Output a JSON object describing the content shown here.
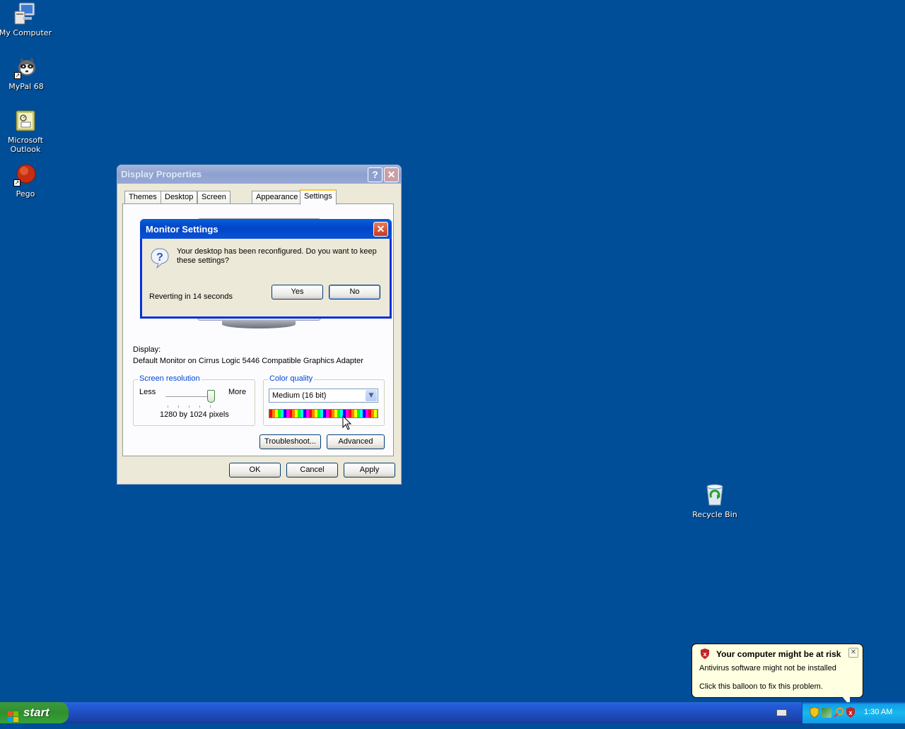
{
  "desktop": {
    "icons": [
      {
        "label": "My Computer"
      },
      {
        "label": "MyPal 68"
      },
      {
        "label": "Microsoft Outlook"
      },
      {
        "label": "Pego"
      },
      {
        "label": "Recycle Bin"
      }
    ]
  },
  "display_properties": {
    "title": "Display Properties",
    "tabs": [
      "Themes",
      "Desktop",
      "Screen Saver",
      "Appearance",
      "Settings"
    ],
    "selected_tab": "Settings",
    "display_label": "Display:",
    "display_value": "Default Monitor on Cirrus Logic 5446 Compatible Graphics Adapter",
    "screen_resolution": {
      "group_label": "Screen resolution",
      "less_label": "Less",
      "more_label": "More",
      "value_text": "1280 by 1024 pixels",
      "slider_level": 1.0
    },
    "color_quality": {
      "group_label": "Color quality",
      "selected": "Medium (16 bit)"
    },
    "buttons": {
      "troubleshoot": "Troubleshoot...",
      "advanced": "Advanced",
      "ok": "OK",
      "cancel": "Cancel",
      "apply": "Apply"
    }
  },
  "monitor_settings": {
    "title": "Monitor Settings",
    "message": "Your desktop has been reconfigured.  Do you want to keep these settings?",
    "countdown": "Reverting in 14 seconds",
    "yes_label": "Yes",
    "no_label": "No"
  },
  "balloon": {
    "title": "Your computer might be at risk",
    "line1": "Antivirus software might not be installed",
    "line2": "Click this balloon to fix this problem."
  },
  "taskbar": {
    "start_label": "start",
    "clock": "1:30 AM"
  },
  "colors": {
    "desktop": "#004e98",
    "title_active": "#0045c8",
    "start_green": "#2f8f2f"
  }
}
